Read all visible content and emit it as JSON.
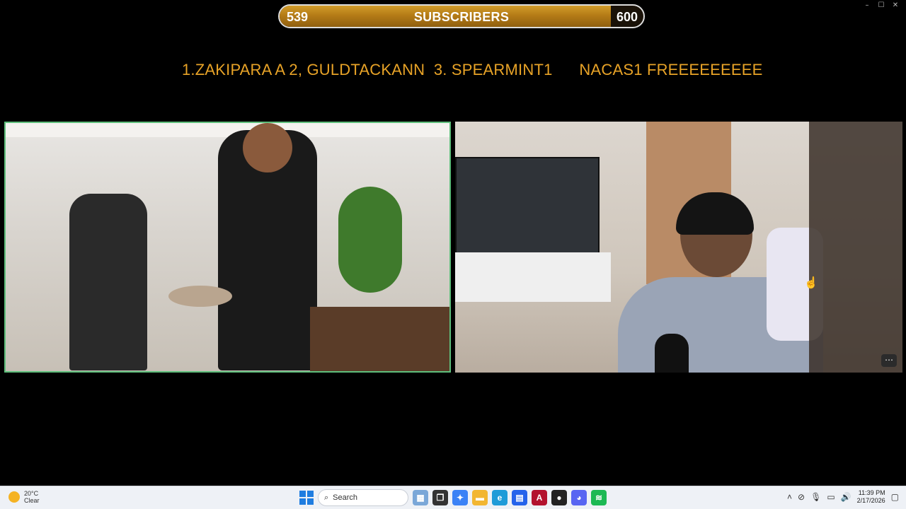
{
  "window_controls": {
    "minimize": "–",
    "maximize": "☐",
    "close": "✕"
  },
  "subscriber_goal": {
    "start": "539",
    "label": "SUBSCRIBERS",
    "goal": "600",
    "progress_fraction": 0.91,
    "fill_color": "#b57c17"
  },
  "ticker": {
    "text": "1.ZAKIPARA A 2, GULDTACKANN  3. SPEARMINT1      NACAS1 FREEEEEEEEE",
    "color": "#e8a327"
  },
  "cameras": {
    "left": {
      "highlight_color": "#5fbf7c"
    },
    "right": {
      "more_label": "⋯"
    }
  },
  "taskbar": {
    "weather": {
      "temp": "20°C",
      "condition": "Clear"
    },
    "search_placeholder": "Search",
    "time": "11:39 PM",
    "date": "2/17/2026"
  }
}
